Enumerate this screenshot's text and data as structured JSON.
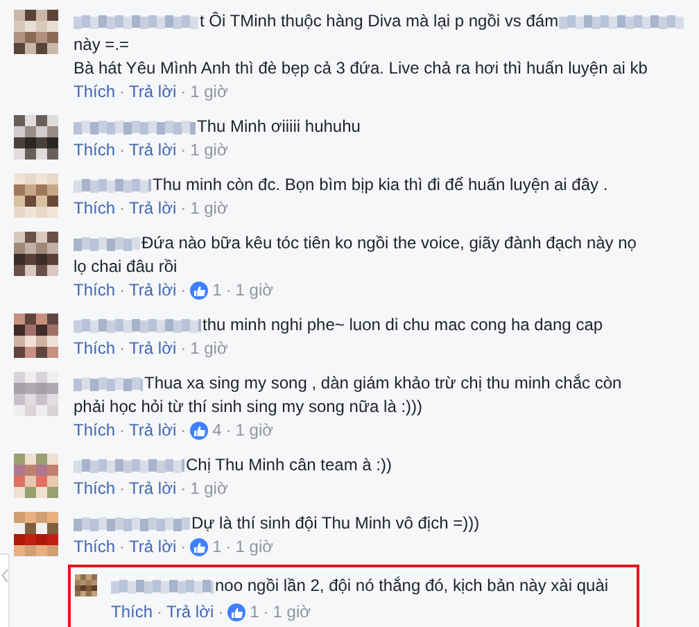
{
  "comments": [
    {
      "lines": [
        [
          {
            "kind": "blur"
          },
          {
            "kind": "text",
            "text": "t Ôi TMinh thuộc hàng Diva mà lại p ngồi vs đám"
          },
          {
            "kind": "blur"
          }
        ],
        [
          {
            "kind": "text",
            "text": "này =.="
          }
        ],
        [
          {
            "kind": "text",
            "text": "Bà hát Yêu Mình Anh thì đè bẹp cả 3 đứa. Live chả ra hơi thì huấn luyện ai kb"
          }
        ]
      ],
      "actions": [
        {
          "kind": "link",
          "text": "Thích"
        },
        {
          "kind": "sep",
          "text": "·"
        },
        {
          "kind": "link",
          "text": "Trả lời"
        },
        {
          "kind": "sep",
          "text": "·"
        },
        {
          "kind": "time",
          "text": "1 giờ"
        }
      ]
    },
    {
      "lines": [
        [
          {
            "kind": "blur"
          },
          {
            "kind": "text",
            "text": "Thu Minh ơiiiii huhuhu"
          }
        ]
      ],
      "actions": [
        {
          "kind": "link",
          "text": "Thích"
        },
        {
          "kind": "sep",
          "text": "·"
        },
        {
          "kind": "link",
          "text": "Trả lời"
        },
        {
          "kind": "sep",
          "text": "·"
        },
        {
          "kind": "time",
          "text": "1 giờ"
        }
      ]
    },
    {
      "lines": [
        [
          {
            "kind": "blur"
          },
          {
            "kind": "text",
            "text": "Thu minh còn đc. Bọn bìm bịp kia thì đi để huấn luyện ai đây ."
          }
        ]
      ],
      "actions": [
        {
          "kind": "link",
          "text": "Thích"
        },
        {
          "kind": "sep",
          "text": "·"
        },
        {
          "kind": "link",
          "text": "Trả lời"
        },
        {
          "kind": "sep",
          "text": "·"
        },
        {
          "kind": "time",
          "text": "1 giờ"
        }
      ]
    },
    {
      "lines": [
        [
          {
            "kind": "blur"
          },
          {
            "kind": "text",
            "text": "Đứa nào bữa kêu tóc tiên ko ngồi the voice, giãy đành đạch này nọ"
          }
        ],
        [
          {
            "kind": "text",
            "text": "lọ chai đâu rồi"
          }
        ]
      ],
      "actions": [
        {
          "kind": "link",
          "text": "Thích"
        },
        {
          "kind": "sep",
          "text": "·"
        },
        {
          "kind": "link",
          "text": "Trả lời"
        },
        {
          "kind": "sep",
          "text": "·"
        },
        {
          "kind": "likes",
          "text": "1"
        },
        {
          "kind": "sep",
          "text": "·"
        },
        {
          "kind": "time",
          "text": "1 giờ"
        }
      ]
    },
    {
      "lines": [
        [
          {
            "kind": "blur"
          },
          {
            "kind": "text",
            "text": "thu minh nghi phe~ luon di chu mac cong ha dang cap"
          }
        ]
      ],
      "actions": [
        {
          "kind": "link",
          "text": "Thích"
        },
        {
          "kind": "sep",
          "text": "·"
        },
        {
          "kind": "link",
          "text": "Trả lời"
        },
        {
          "kind": "sep",
          "text": "·"
        },
        {
          "kind": "time",
          "text": "1 giờ"
        }
      ]
    },
    {
      "lines": [
        [
          {
            "kind": "blur"
          },
          {
            "kind": "text",
            "text": "Thua xa sing my song , dàn giám khảo trừ chị thu minh chắc còn"
          }
        ],
        [
          {
            "kind": "text",
            "text": "phải học hỏi từ thí sinh sing my song nữa là :)))"
          }
        ]
      ],
      "actions": [
        {
          "kind": "link",
          "text": "Thích"
        },
        {
          "kind": "sep",
          "text": "·"
        },
        {
          "kind": "link",
          "text": "Trả lời"
        },
        {
          "kind": "sep",
          "text": "·"
        },
        {
          "kind": "likes",
          "text": "4"
        },
        {
          "kind": "sep",
          "text": "·"
        },
        {
          "kind": "time",
          "text": "1 giờ"
        }
      ]
    },
    {
      "lines": [
        [
          {
            "kind": "blur"
          },
          {
            "kind": "text",
            "text": "Chị Thu Minh cân team à :))"
          }
        ]
      ],
      "actions": [
        {
          "kind": "link",
          "text": "Thích"
        },
        {
          "kind": "sep",
          "text": "·"
        },
        {
          "kind": "link",
          "text": "Trả lời"
        },
        {
          "kind": "sep",
          "text": "·"
        },
        {
          "kind": "time",
          "text": "1 giờ"
        }
      ]
    },
    {
      "lines": [
        [
          {
            "kind": "blur"
          },
          {
            "kind": "text",
            "text": "Dự là thí sinh đội Thu Minh vô địch =)))"
          }
        ]
      ],
      "actions": [
        {
          "kind": "link",
          "text": "Thích"
        },
        {
          "kind": "sep",
          "text": "·"
        },
        {
          "kind": "link",
          "text": "Trả lời"
        },
        {
          "kind": "sep",
          "text": "·"
        },
        {
          "kind": "likes",
          "text": "1"
        },
        {
          "kind": "sep",
          "text": "·"
        },
        {
          "kind": "time",
          "text": "1 giờ"
        }
      ],
      "replies": [
        {
          "highlighted": true,
          "lines": [
            [
              {
                "kind": "blur"
              },
              {
                "kind": "text",
                "text": "noo ngồi lần 2, đội nó thắng đó, kịch bản này xài quài"
              }
            ]
          ],
          "actions": [
            {
              "kind": "link",
              "text": "Thích"
            },
            {
              "kind": "sep",
              "text": "·"
            },
            {
              "kind": "link",
              "text": "Trả lời"
            },
            {
              "kind": "sep",
              "text": "·"
            },
            {
              "kind": "likes",
              "text": "1"
            },
            {
              "kind": "sep",
              "text": "·"
            },
            {
              "kind": "time",
              "text": "1 giờ"
            }
          ]
        }
      ]
    }
  ]
}
